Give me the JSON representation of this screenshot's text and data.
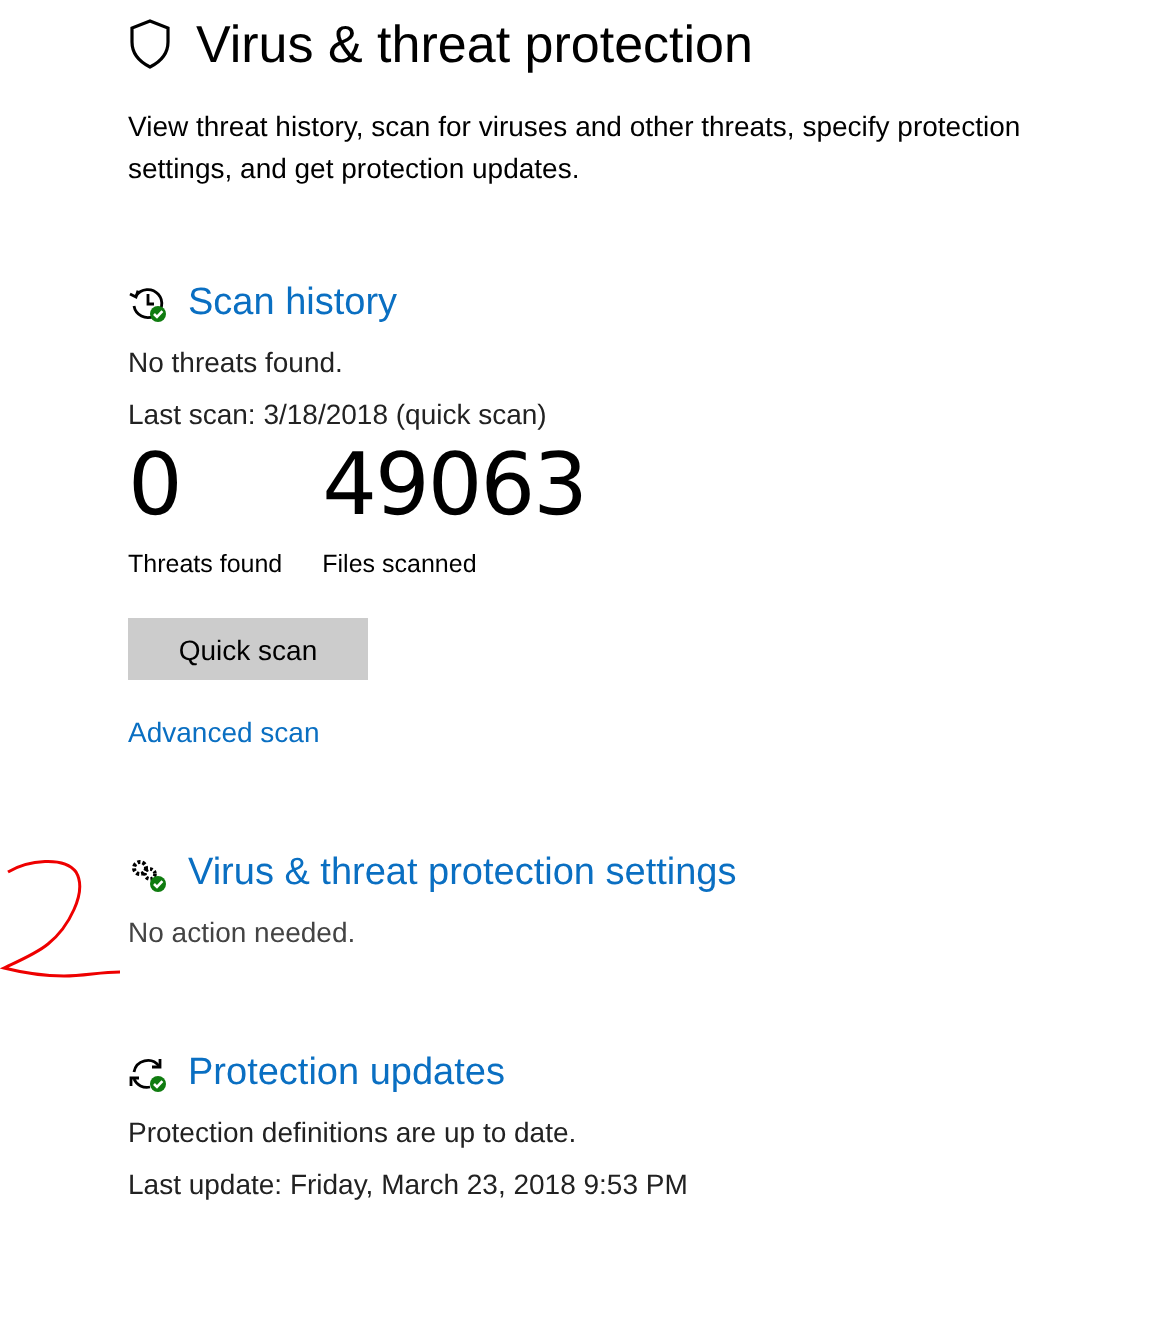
{
  "page": {
    "title": "Virus & threat protection",
    "description": "View threat history, scan for viruses and other threats, specify protection settings, and get protection updates."
  },
  "scan_history": {
    "heading": "Scan history",
    "status": "No threats found.",
    "last_scan": "Last scan: 3/18/2018 (quick scan)",
    "stats": [
      {
        "value": "0",
        "label": "Threats found"
      },
      {
        "value": "49063",
        "label": "Files scanned"
      }
    ],
    "button": "Quick scan",
    "link": "Advanced scan"
  },
  "settings": {
    "heading": "Virus & threat protection settings",
    "status": "No action needed."
  },
  "updates": {
    "heading": "Protection updates",
    "lines": [
      "Protection definitions are up to date.",
      "Last update: Friday, March 23, 2018 9:53 PM"
    ]
  }
}
